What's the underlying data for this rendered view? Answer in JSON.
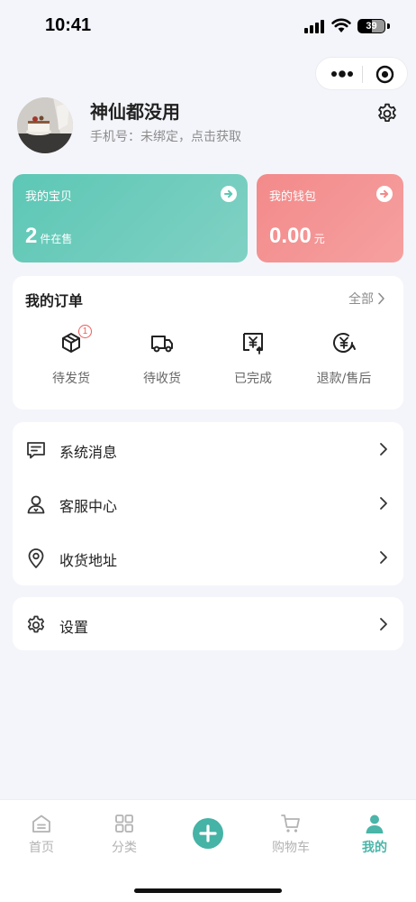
{
  "status_bar": {
    "time": "10:41",
    "battery": "39"
  },
  "profile": {
    "name": "神仙都没用",
    "phone": "手机号：未绑定，点击获取"
  },
  "cards": {
    "goods": {
      "title": "我的宝贝",
      "value": "2",
      "unit": "件在售"
    },
    "wallet": {
      "title": "我的钱包",
      "value": "0.00",
      "unit": "元"
    }
  },
  "orders": {
    "title": "我的订单",
    "all_label": "全部",
    "items": [
      {
        "label": "待发货",
        "badge": "1"
      },
      {
        "label": "待收货"
      },
      {
        "label": "已完成"
      },
      {
        "label": "退款/售后"
      }
    ]
  },
  "menu": [
    {
      "label": "系统消息"
    },
    {
      "label": "客服中心"
    },
    {
      "label": "收货地址"
    }
  ],
  "settings_menu": {
    "label": "设置"
  },
  "tabbar": [
    {
      "label": "首页"
    },
    {
      "label": "分类"
    },
    {
      "label": "购物车"
    },
    {
      "label": "我的"
    }
  ],
  "colors": {
    "accent": "#4ab5a8",
    "goods_card": "#5dc7b5",
    "wallet_card": "#f38a8a",
    "badge": "#f05a5a"
  }
}
